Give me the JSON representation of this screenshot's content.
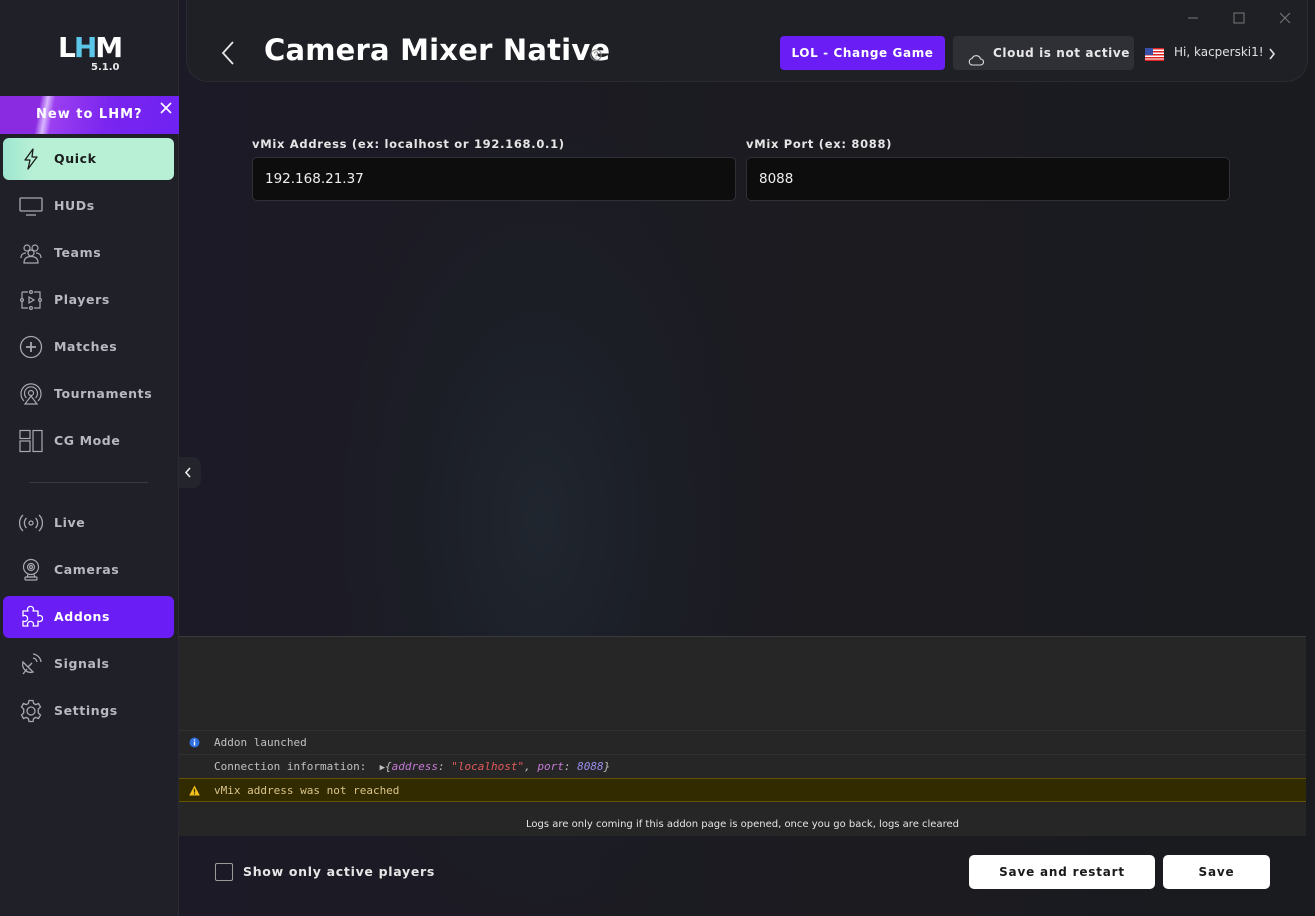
{
  "app": {
    "logo": "LHM",
    "version": "5.1.0"
  },
  "promo": {
    "text": "New to LHM?",
    "close_icon": "close-icon"
  },
  "sidebar": {
    "items": [
      {
        "label": "Quick",
        "icon": "lightning-icon",
        "state": "highlight"
      },
      {
        "label": "HUDs",
        "icon": "monitor-icon"
      },
      {
        "label": "Teams",
        "icon": "users-icon"
      },
      {
        "label": "Players",
        "icon": "player-icon"
      },
      {
        "label": "Matches",
        "icon": "plus-circle-icon"
      },
      {
        "label": "Tournaments",
        "icon": "broadcast-icon"
      },
      {
        "label": "CG Mode",
        "icon": "layout-icon"
      },
      {
        "label": "Live",
        "icon": "live-signal-icon"
      },
      {
        "label": "Cameras",
        "icon": "webcam-icon"
      },
      {
        "label": "Addons",
        "icon": "puzzle-icon",
        "state": "active"
      },
      {
        "label": "Signals",
        "icon": "satellite-dish-icon"
      },
      {
        "label": "Settings",
        "icon": "gear-icon"
      }
    ]
  },
  "header": {
    "title": "Camera Mixer Native",
    "game_button": "LOL - Change Game",
    "cloud_status": "Cloud is not active",
    "greeting": "Hi, kacperski1!",
    "accent": "#6a1ef5"
  },
  "form": {
    "address_label": "vMix Address (ex: localhost or 192.168.0.1)",
    "address_value": "192.168.21.37",
    "port_label": "vMix Port (ex: 8088)",
    "port_value": "8088"
  },
  "logs": {
    "entries": [
      {
        "level": "info",
        "message": "Addon launched"
      },
      {
        "level": "log",
        "message": "Connection information:  ",
        "object": {
          "prefix": "{",
          "key1": "address",
          "sep1": ": ",
          "val1": "\"localhost\"",
          "comma": ", ",
          "key2": "port",
          "sep2": ": ",
          "val2": "8088",
          "suffix": "}"
        }
      },
      {
        "level": "warn",
        "message": "vMix address was not reached"
      }
    ],
    "note": "Logs are only coming if this addon page is opened, once you go back, logs are cleared"
  },
  "footer": {
    "checkbox_label": "Show only active players",
    "checkbox_checked": false,
    "save_restart": "Save and restart",
    "save": "Save"
  }
}
